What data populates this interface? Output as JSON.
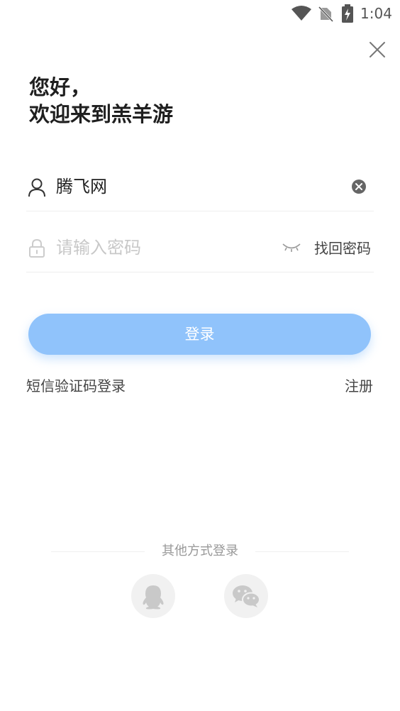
{
  "status_bar": {
    "time": "1:04"
  },
  "greeting": {
    "line1": "您好，",
    "line2": "欢迎来到羔羊游"
  },
  "username": {
    "value": "腾飞网"
  },
  "password": {
    "placeholder": "请输入密码",
    "forgot_label": "找回密码"
  },
  "login_button": {
    "label": "登录"
  },
  "links": {
    "sms_login": "短信验证码登录",
    "register": "注册"
  },
  "other_login": {
    "label": "其他方式登录"
  },
  "icons": {
    "status": [
      "wifi-icon",
      "no-sim-icon",
      "battery-charging-icon"
    ],
    "close": "close-icon",
    "user": "user-icon",
    "lock": "lock-icon",
    "clear": "clear-icon",
    "eye": "eye-closed-icon",
    "social": [
      "qq-icon",
      "wechat-icon"
    ]
  },
  "colors": {
    "primary_button": "#90c3fb",
    "placeholder": "#c8c8c8",
    "social_bg": "#f1f1f1"
  }
}
